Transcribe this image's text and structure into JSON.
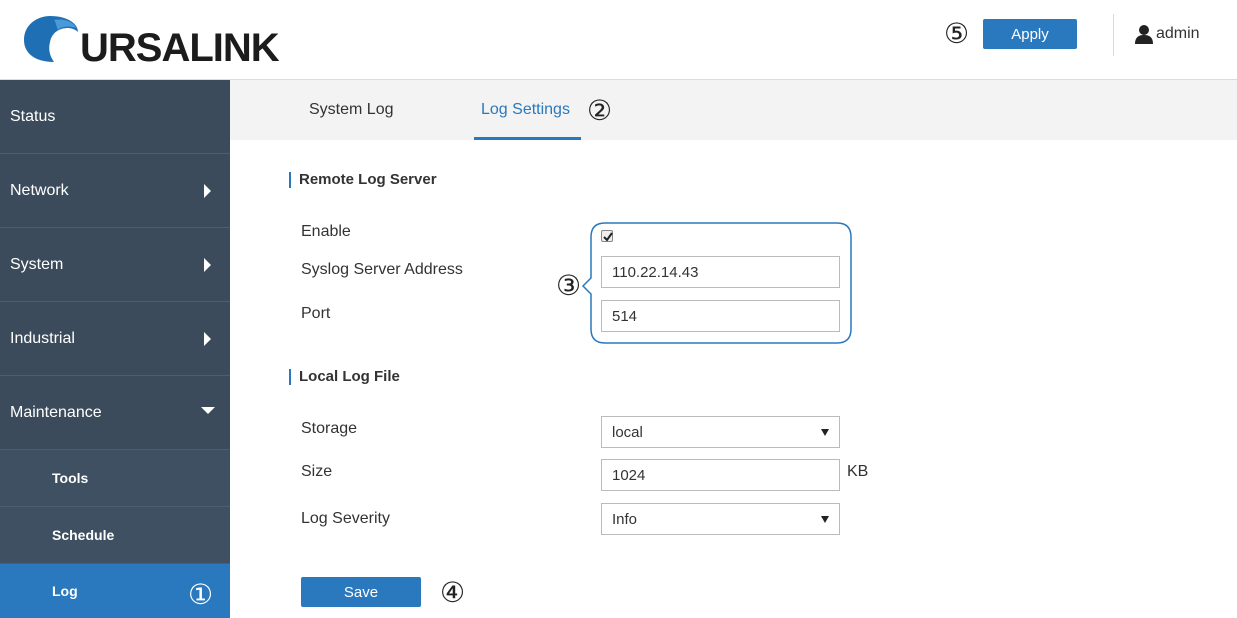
{
  "header": {
    "brand": "URSALINK",
    "apply_label": "Apply",
    "apply_marker": "⑤",
    "user": "admin"
  },
  "sidebar": {
    "items": [
      {
        "label": "Status"
      },
      {
        "label": "Network"
      },
      {
        "label": "System"
      },
      {
        "label": "Industrial"
      },
      {
        "label": "Maintenance"
      }
    ],
    "subitems": [
      {
        "label": "Tools"
      },
      {
        "label": "Schedule"
      },
      {
        "label": "Log"
      }
    ],
    "log_marker": "①"
  },
  "tabs": {
    "items": [
      {
        "label": "System Log"
      },
      {
        "label": "Log Settings"
      }
    ],
    "active": "Log Settings",
    "marker": "②"
  },
  "remote": {
    "title": "Remote Log Server",
    "enable_label": "Enable",
    "enable_checked": true,
    "address_label": "Syslog Server Address",
    "address_value": "110.22.14.43",
    "port_label": "Port",
    "port_value": "514",
    "marker": "③"
  },
  "local": {
    "title": "Local Log File",
    "storage_label": "Storage",
    "storage_value": "local",
    "size_label": "Size",
    "size_value": "1024",
    "size_unit": "KB",
    "severity_label": "Log Severity",
    "severity_value": "Info"
  },
  "footer": {
    "save_label": "Save",
    "save_marker": "④"
  },
  "colors": {
    "accent": "#2a78bd",
    "sidebar": "#3b4b5c"
  },
  "icons": {
    "user": "user-icon",
    "logo": "ursalink-logo-icon",
    "check": "checkmark-icon"
  }
}
